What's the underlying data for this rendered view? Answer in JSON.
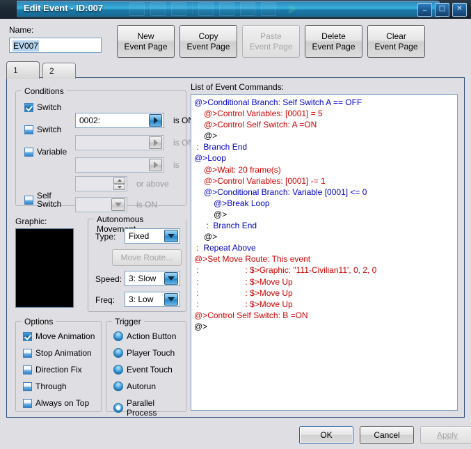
{
  "window": {
    "title": "Edit Event - ID:007",
    "controls": {
      "minimize": "–",
      "maximize": "□",
      "close": "✕"
    }
  },
  "name": {
    "label": "Name:",
    "value": "EV007"
  },
  "page_buttons": [
    {
      "line1": "New",
      "line2": "Event Page",
      "enabled": true
    },
    {
      "line1": "Copy",
      "line2": "Event Page",
      "enabled": true
    },
    {
      "line1": "Paste",
      "line2": "Event Page",
      "enabled": false
    },
    {
      "line1": "Delete",
      "line2": "Event Page",
      "enabled": true
    },
    {
      "line1": "Clear",
      "line2": "Event Page",
      "enabled": true
    }
  ],
  "tabs": [
    {
      "label": "1",
      "active": true
    },
    {
      "label": "2",
      "active": false
    }
  ],
  "conditions": {
    "title": "Conditions",
    "rows": [
      {
        "label": "Switch",
        "checked": true,
        "value": "0002:",
        "suffix": "is ON",
        "enabled": true
      },
      {
        "label": "Switch",
        "checked": false,
        "value": "",
        "suffix": "is ON",
        "enabled": false
      },
      {
        "label": "Variable",
        "checked": false,
        "value": "",
        "suffix": "is",
        "enabled": false
      },
      {
        "label": "",
        "checked": null,
        "value": "",
        "suffix": "or above",
        "enabled": false
      },
      {
        "label": "Self Switch",
        "checked": false,
        "value": "",
        "suffix": "is ON",
        "enabled": false
      }
    ]
  },
  "graphic": {
    "label": "Graphic:"
  },
  "autonomous": {
    "title": "Autonomous Movement",
    "type_label": "Type:",
    "type_value": "Fixed",
    "move_route_label": "Move Route...",
    "speed_label": "Speed:",
    "speed_value": "3: Slow",
    "freq_label": "Freq:",
    "freq_value": "3: Low"
  },
  "options": {
    "title": "Options",
    "items": [
      {
        "label": "Move Animation",
        "checked": true
      },
      {
        "label": "Stop Animation",
        "checked": false
      },
      {
        "label": "Direction Fix",
        "checked": false
      },
      {
        "label": "Through",
        "checked": false
      },
      {
        "label": "Always on Top",
        "checked": false
      }
    ]
  },
  "trigger": {
    "title": "Trigger",
    "items": [
      {
        "label": "Action Button",
        "selected": false
      },
      {
        "label": "Player Touch",
        "selected": false
      },
      {
        "label": "Event Touch",
        "selected": false
      },
      {
        "label": "Autorun",
        "selected": false
      },
      {
        "label": "Parallel Process",
        "selected": true
      }
    ]
  },
  "commands": {
    "label": "List of Event Commands:",
    "lines": [
      {
        "indent": 0,
        "text": "@>Conditional Branch: Self Switch A == OFF",
        "color": "blue"
      },
      {
        "indent": 1,
        "text": "@>Control Variables: [0001] = 5",
        "color": "red"
      },
      {
        "indent": 1,
        "text": "@>Control Self Switch: A =ON",
        "color": "red"
      },
      {
        "indent": 1,
        "text": "@>",
        "color": "black"
      },
      {
        "indent": 0,
        "text": " :  Branch End",
        "color": "blue"
      },
      {
        "indent": 0,
        "text": "@>Loop",
        "color": "blue"
      },
      {
        "indent": 1,
        "text": "@>Wait: 20 frame(s)",
        "color": "red"
      },
      {
        "indent": 1,
        "text": "@>Control Variables: [0001] -= 1",
        "color": "red"
      },
      {
        "indent": 1,
        "text": "@>Conditional Branch: Variable [0001] <= 0",
        "color": "blue"
      },
      {
        "indent": 2,
        "text": "@>Break Loop",
        "color": "blue"
      },
      {
        "indent": 2,
        "text": "@>",
        "color": "black"
      },
      {
        "indent": 1,
        "text": " :  Branch End",
        "color": "blue"
      },
      {
        "indent": 1,
        "text": "@>",
        "color": "black"
      },
      {
        "indent": 0,
        "text": " :  Repeat Above",
        "color": "blue"
      },
      {
        "indent": 0,
        "text": "@>Set Move Route: This event",
        "color": "red"
      },
      {
        "indent": 0,
        "text": " :                    : $>Graphic: \"111-Civilian11', 0, 2, 0",
        "color": "red"
      },
      {
        "indent": 0,
        "text": " :                    : $>Move Up",
        "color": "red"
      },
      {
        "indent": 0,
        "text": " :                    : $>Move Up",
        "color": "red"
      },
      {
        "indent": 0,
        "text": " :                    : $>Move Up",
        "color": "red"
      },
      {
        "indent": 0,
        "text": "@>Control Self Switch: B =ON",
        "color": "red"
      },
      {
        "indent": 0,
        "text": "@>",
        "color": "black"
      }
    ]
  },
  "footer": {
    "ok": "OK",
    "cancel": "Cancel",
    "apply": "Apply"
  }
}
